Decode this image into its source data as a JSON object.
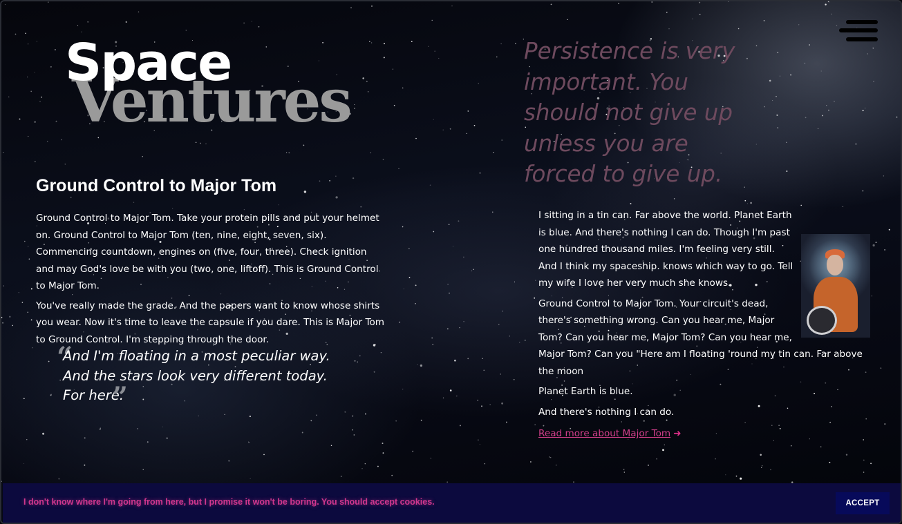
{
  "menu": {
    "icon": "hamburger-menu-icon"
  },
  "logo": {
    "line1": "Space",
    "line2": "Ventures"
  },
  "left": {
    "heading": "Ground Control to Major Tom",
    "paragraphs": [
      "Ground Control to Major Tom. Take your protein pills and put your helmet on. Ground Control to Major Tom (ten, nine, eight, seven, six). Commencing countdown, engines on (five, four, three). Check ignition and may God's love be with you (two, one, liftoff). This is Ground Control to Major Tom.",
      "You've really made the grade. And the papers want to know whose shirts you wear. Now it's time to leave the capsule if you dare. This is Major Tom to Ground Control. I'm stepping through the door."
    ],
    "quote": {
      "open_mark": "“",
      "close_mark": "”",
      "lines": [
        "And I'm floating in a most peculiar way.",
        "And the stars look very different today.",
        "For here."
      ]
    }
  },
  "right": {
    "quote": "Persistence is very important. You should not give up unless you are forced to give up.",
    "paragraphs": [
      "I sitting in a tin can. Far above the world. Planet Earth is blue. And there's nothing I can do. Though I'm past one hundred thousand miles. I'm feeling very still. And I think my spaceship. knows which way to go. Tell my wife I love her very much she knows.",
      "Ground Control to Major Tom. Your circuit's dead, there's something wrong. Can you hear me, Major Tom? Can you hear me, Major Tom? Can you hear me, Major Tom? Can you \"Here am I floating 'round my tin can. Far above the moon",
      "Planet Earth is blue.",
      "And there's nothing I can do."
    ],
    "read_more": "Read more about Major Tom",
    "arrow": "➜"
  },
  "cookie": {
    "message": "I don't know where I'm going from here, but I promise it won't be boring. You should accept cookies.",
    "accept_label": "ACCEPT"
  },
  "colors": {
    "accent_pink": "#d23f8a",
    "cookie_bg": "#0c0a3e",
    "accept_bg": "#070a5a",
    "quote_muted": "#6e4a5e"
  }
}
